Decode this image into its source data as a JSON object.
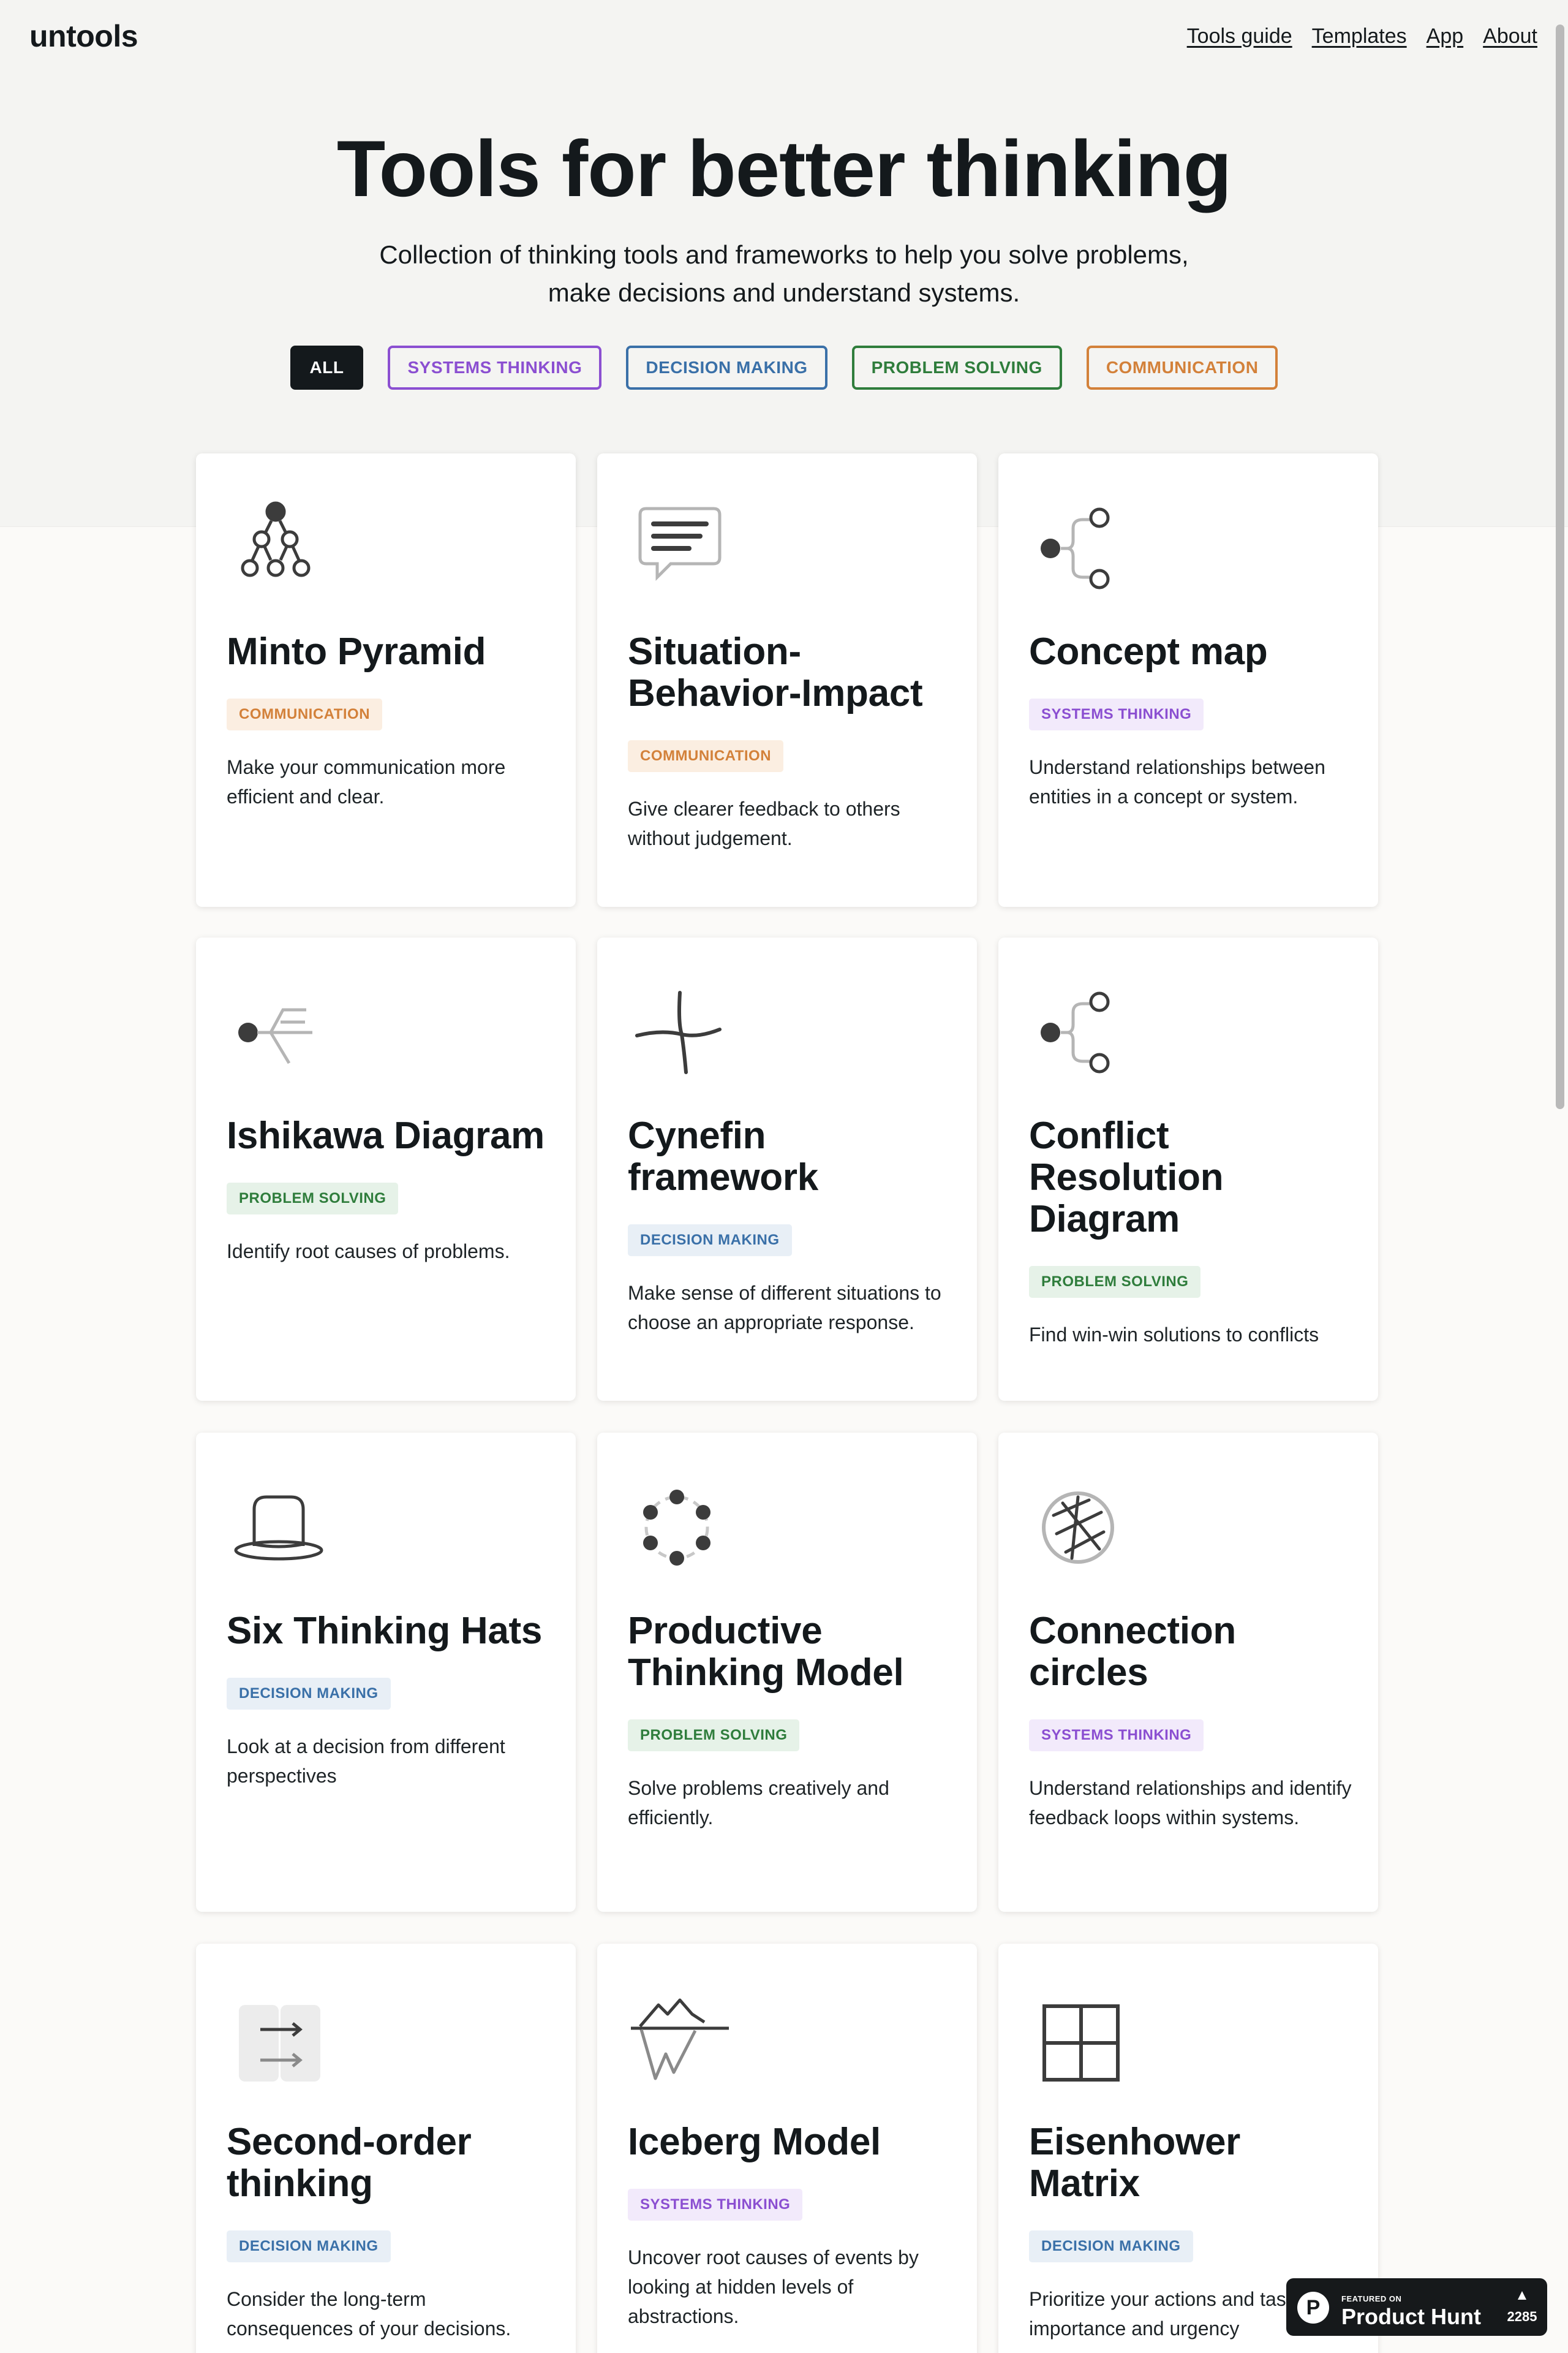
{
  "header": {
    "logo": "untools",
    "nav": [
      "Tools guide",
      "Templates",
      "App",
      "About"
    ]
  },
  "hero": {
    "title": "Tools for better thinking",
    "subtitle_line1": "Collection of thinking tools and frameworks to help you solve problems,",
    "subtitle_line2": "make decisions and understand systems."
  },
  "filters": {
    "all": "ALL",
    "systems": "SYSTEMS THINKING",
    "decision": "DECISION MAKING",
    "problem": "PROBLEM SOLVING",
    "communication": "COMMUNICATION"
  },
  "colors": {
    "communication": "#d3813a",
    "systems_thinking": "#8b4fd1",
    "decision_making": "#3a70a8",
    "problem_solving": "#2f7d3c",
    "text": "#14191c"
  },
  "cards": [
    {
      "title": "Minto Pyramid",
      "tag": "COMMUNICATION",
      "desc": "Make your communication more efficient and clear.",
      "icon": "pyramid-icon"
    },
    {
      "title": "Situation-Behavior-Impact",
      "tag": "COMMUNICATION",
      "desc": "Give clearer feedback to others without judgement.",
      "icon": "speech-bubble-icon"
    },
    {
      "title": "Concept map",
      "tag": "SYSTEMS THINKING",
      "desc": "Understand relationships between entities in a concept or system.",
      "icon": "concept-map-icon"
    },
    {
      "title": "Ishikawa Diagram",
      "tag": "PROBLEM SOLVING",
      "desc": "Identify root causes of problems.",
      "icon": "fishbone-icon"
    },
    {
      "title": "Cynefin framework",
      "tag": "DECISION MAKING",
      "desc": "Make sense of different situations to choose an appropriate response.",
      "icon": "cynefin-icon"
    },
    {
      "title": "Conflict Resolution Diagram",
      "tag": "PROBLEM SOLVING",
      "desc": "Find win-win solutions to conflicts",
      "icon": "conflict-diagram-icon"
    },
    {
      "title": "Six Thinking Hats",
      "tag": "DECISION MAKING",
      "desc": "Look at a decision from different perspectives",
      "icon": "hat-icon"
    },
    {
      "title": "Productive Thinking Model",
      "tag": "PROBLEM SOLVING",
      "desc": "Solve problems creatively and efficiently.",
      "icon": "cycle-dots-icon"
    },
    {
      "title": "Connection circles",
      "tag": "SYSTEMS THINKING",
      "desc": "Understand relationships and identify feedback loops within systems.",
      "icon": "connection-circle-icon"
    },
    {
      "title": "Second-order thinking",
      "tag": "DECISION MAKING",
      "desc": "Consider the long-term consequences of your decisions.",
      "icon": "arrows-icon"
    },
    {
      "title": "Iceberg Model",
      "tag": "SYSTEMS THINKING",
      "desc": "Uncover root causes of events by looking at hidden levels of abstractions.",
      "icon": "iceberg-icon"
    },
    {
      "title": "Eisenhower Matrix",
      "tag": "DECISION MAKING",
      "desc": "Prioritize your actions and tasks by importance and urgency",
      "icon": "matrix-icon"
    }
  ],
  "product_hunt": {
    "small": "FEATURED ON",
    "big": "Product Hunt",
    "letter": "P",
    "arrow": "▲",
    "count": "2285"
  }
}
